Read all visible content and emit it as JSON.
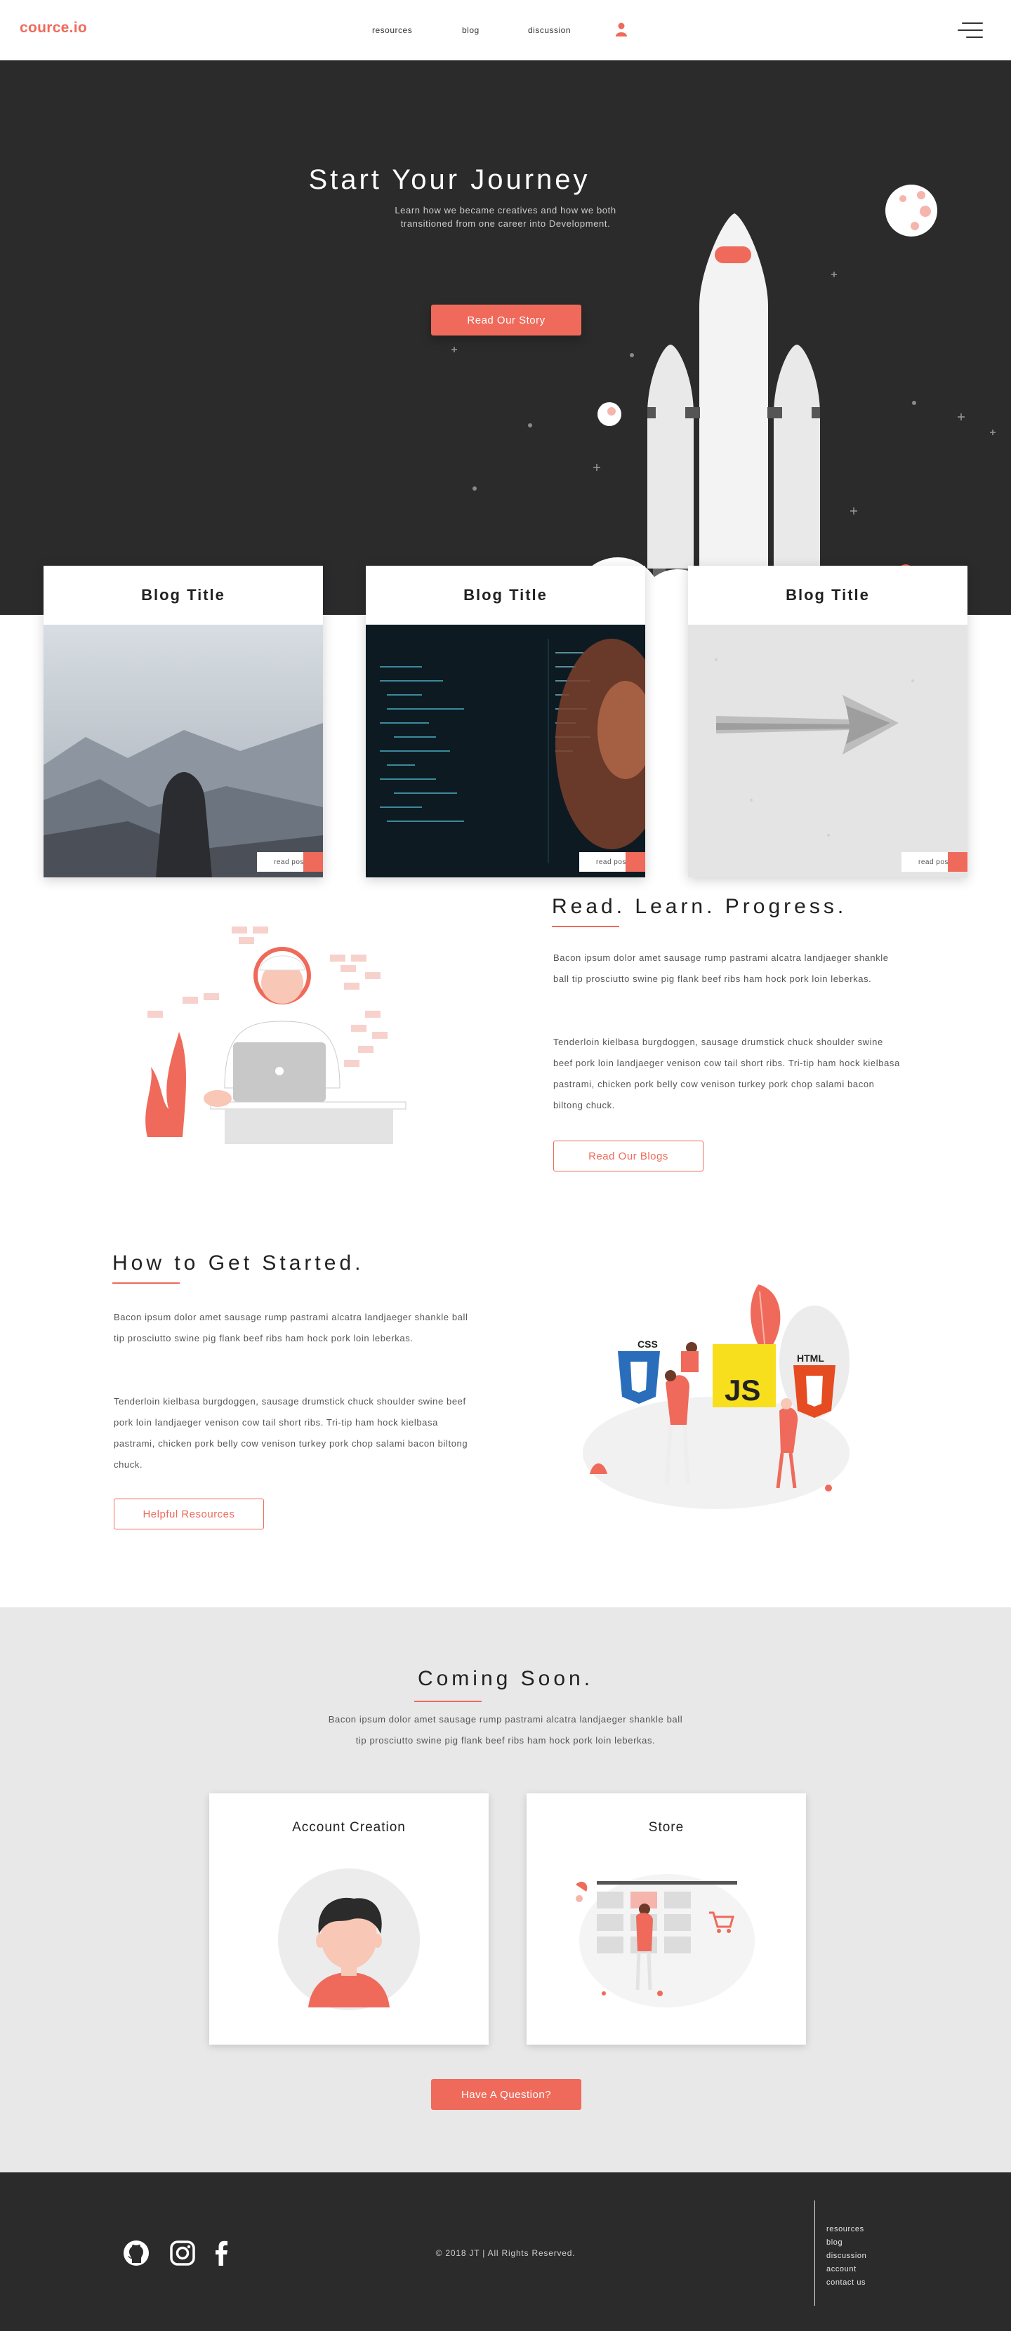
{
  "nav": {
    "logo": "cource.io",
    "links": [
      "resources",
      "blog",
      "discussion"
    ]
  },
  "hero": {
    "title": "Start Your Journey",
    "subtitle_line1": "Learn how we became creatives and how we both",
    "subtitle_line2": "transitioned from one career into Development.",
    "button": "Read Our Story"
  },
  "blogs": [
    {
      "title": "Blog Title",
      "read_label": "read post",
      "image": "mountain-hiker"
    },
    {
      "title": "Blog Title",
      "read_label": "read post",
      "image": "code-screen"
    },
    {
      "title": "Blog Title",
      "read_label": "read post",
      "image": "paper-arrow"
    }
  ],
  "read_learn": {
    "heading": "Read. Learn. Progress.",
    "para1": "Bacon ipsum dolor amet sausage rump pastrami alcatra landjaeger shankle ball tip prosciutto swine pig flank beef ribs ham hock pork loin leberkas.",
    "para2": "Tenderloin kielbasa burgdoggen, sausage drumstick chuck shoulder swine beef pork loin landjaeger venison cow tail short ribs. Tri-tip ham hock kielbasa pastrami, chicken pork belly cow venison turkey pork chop salami bacon biltong chuck.",
    "button": "Read Our Blogs"
  },
  "get_started": {
    "heading": "How to Get Started.",
    "para1": "Bacon ipsum dolor amet sausage rump pastrami alcatra landjaeger shankle ball tip prosciutto swine pig flank beef ribs ham hock pork loin leberkas.",
    "para2": "Tenderloin kielbasa burgdoggen, sausage drumstick chuck shoulder swine beef pork loin landjaeger venison cow tail short ribs. Tri-tip ham hock kielbasa pastrami, chicken pork belly cow venison turkey pork chop salami bacon biltong chuck.",
    "button": "Helpful Resources",
    "badges": {
      "css": "CSS",
      "js": "JS",
      "html": "HTML"
    }
  },
  "coming_soon": {
    "heading": "Coming Soon.",
    "text": "Bacon ipsum dolor amet sausage rump pastrami alcatra landjaeger shankle ball tip prosciutto swine pig flank beef ribs ham hock pork loin leberkas.",
    "cards": [
      {
        "title": "Account Creation"
      },
      {
        "title": "Store"
      }
    ],
    "button": "Have A Question?"
  },
  "footer": {
    "copyright": "© 2018 JT | All Rights Reserved.",
    "links": [
      "resources",
      "blog",
      "discussion",
      "account",
      "contact us"
    ],
    "social": [
      "github-icon",
      "instagram-icon",
      "facebook-icon"
    ]
  },
  "colors": {
    "accent": "#ef6a5b",
    "dark": "#2b2b2c",
    "light_gray": "#e8e8e8"
  }
}
